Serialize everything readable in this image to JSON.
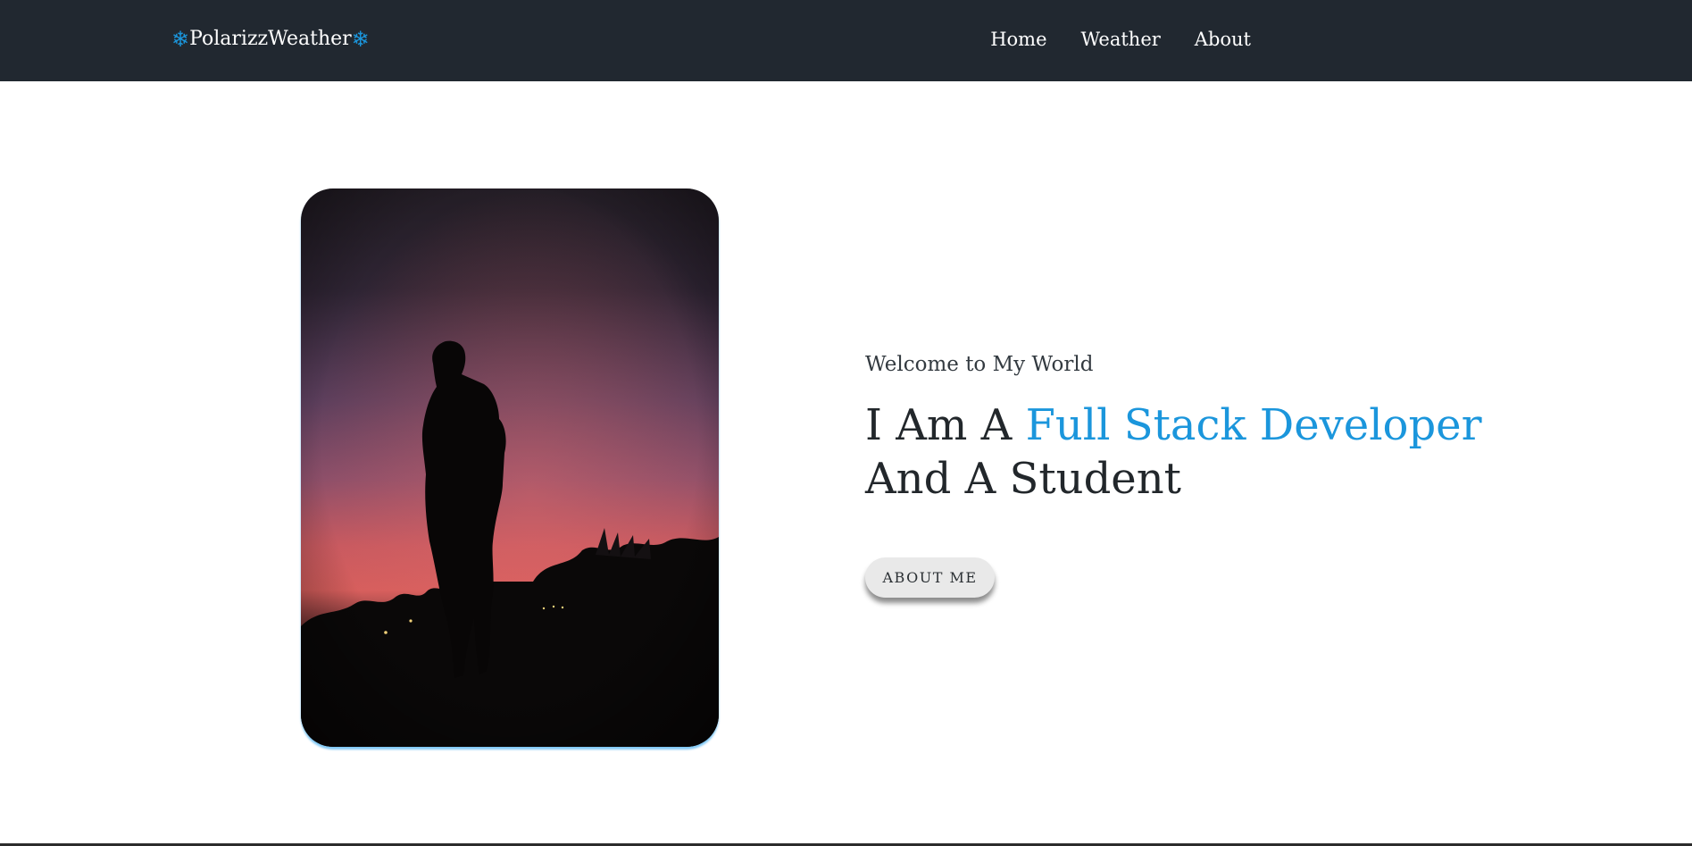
{
  "navbar": {
    "brand_icon_left": "❄",
    "brand_name": "PolarizzWeather",
    "brand_icon_right": "❄",
    "links": [
      "Home",
      "Weather",
      "About"
    ]
  },
  "hero": {
    "photo_alt": "Silhouette of a person against a purple and pink sunset sky",
    "welcome": "Welcome to My World",
    "headline_prefix": "I Am A ",
    "headline_accent": "Full Stack Developer",
    "headline_suffix": "And A Student",
    "button_label": "ABOUT ME"
  },
  "colors": {
    "navbar_bg": "#212830",
    "accent": "#1b96dc",
    "button_bg": "#e9e9e9"
  }
}
